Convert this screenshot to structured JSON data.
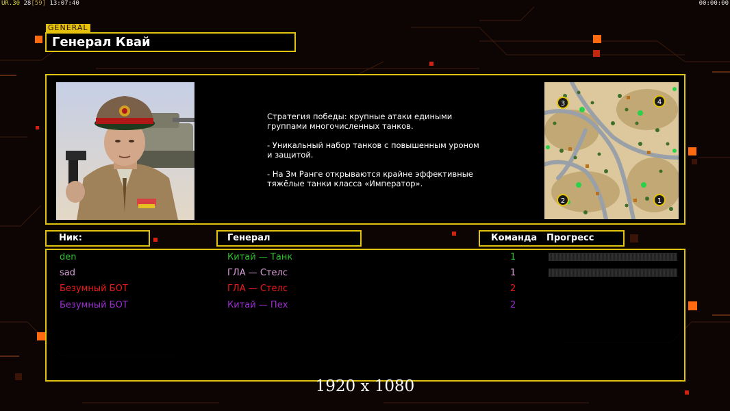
{
  "topbar": {
    "a": "UR.30",
    "b": "28",
    "c": "[59]",
    "time": "13:07:40",
    "right_clock": "00:00:00"
  },
  "general": {
    "tag": "GENERAL",
    "name": "Генерал Квай",
    "description": "Стратегия победы: крупные атаки едиными\n группами многочисленных танков.\n\n- Уникальный набор танков с повышенным уроном\n и защитой.\n\n- На 3м Ранге открываются крайне эффективные\n тяжёлые танки класса «Император»."
  },
  "minimap": {
    "starts": [
      "3",
      "4",
      "2",
      "1"
    ]
  },
  "headers": {
    "nick": "Ник:",
    "general": "Генерал",
    "team": "Команда",
    "progress": "Прогресс"
  },
  "players": [
    {
      "nick": "den",
      "general": "Китай — Танк",
      "team": "1",
      "color": "#2fbf2f",
      "progress_bar": true
    },
    {
      "nick": "sad",
      "general": "ГЛА — Стелс",
      "team": "1",
      "color": "#d8a0d8",
      "progress_bar": true
    },
    {
      "nick": "Безумный БОТ",
      "general": "ГЛА — Стелс",
      "team": "2",
      "color": "#ee1b1b",
      "progress_bar": false
    },
    {
      "nick": "Безумный БОТ",
      "general": "Китай — Пех",
      "team": "2",
      "color": "#9b2fd0",
      "progress_bar": false
    }
  ],
  "resolution_label": "1920 x 1080",
  "colors": {
    "accent": "#e2c30f",
    "background": "#0d0503",
    "orange_square": "#ff6a10",
    "red_square": "#d42010"
  }
}
